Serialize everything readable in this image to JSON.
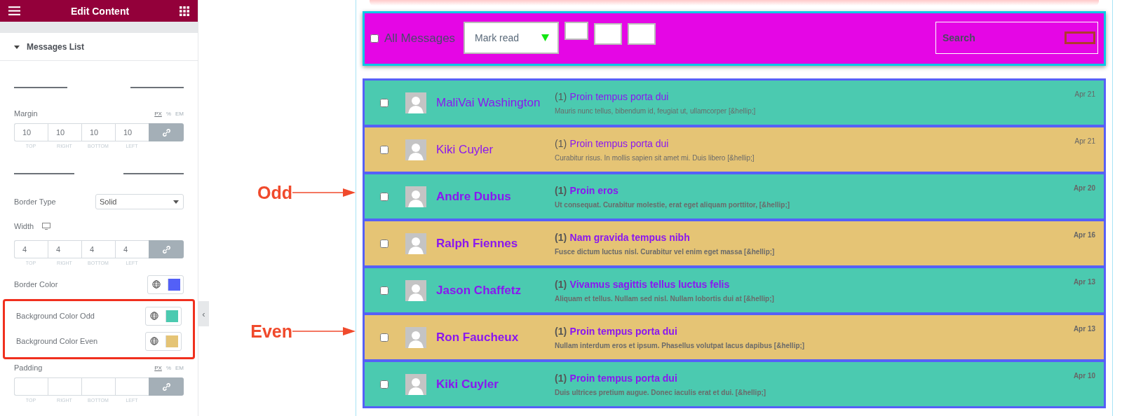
{
  "panel": {
    "title": "Edit Content",
    "section": "Messages List",
    "margin": {
      "label": "Margin",
      "units": [
        {
          "label": "PX",
          "selected": true
        },
        {
          "label": "%",
          "selected": false
        },
        {
          "label": "EM",
          "selected": false
        }
      ],
      "values": [
        "10",
        "10",
        "10",
        "10"
      ],
      "sides": [
        "TOP",
        "RIGHT",
        "BOTTOM",
        "LEFT"
      ]
    },
    "border_type": {
      "label": "Border Type",
      "value": "Solid"
    },
    "width": {
      "label": "Width",
      "values": [
        "4",
        "4",
        "4",
        "4"
      ],
      "sides": [
        "TOP",
        "RIGHT",
        "BOTTOM",
        "LEFT"
      ]
    },
    "colors": [
      {
        "label": "Border Color",
        "color": "#5360f7",
        "highlighted": false
      },
      {
        "label": "Background Color Odd",
        "color": "#4bcab0",
        "highlighted": true
      },
      {
        "label": "Background Color Even",
        "color": "#e5c475",
        "highlighted": true
      }
    ],
    "padding": {
      "label": "Padding",
      "units": [
        {
          "label": "PX",
          "selected": true
        },
        {
          "label": "%",
          "selected": false
        },
        {
          "label": "EM",
          "selected": false
        }
      ],
      "sides": [
        "TOP",
        "RIGHT",
        "BOTTOM",
        "LEFT"
      ]
    }
  },
  "toolbar": {
    "select_all_label": "All Messages",
    "select_all_checked": false,
    "action": "Mark read",
    "search": {
      "placeholder": "Search"
    }
  },
  "collapse_glyph": "‹",
  "messages": [
    {
      "name": "MaliVai Washington",
      "count": "(1)",
      "subject": "Proin tempus porta dui",
      "excerpt": "Mauris nunc tellus, bibendum id, feugiat ut, ullamcorper [&hellip;]",
      "date": "Apr 21",
      "unread": false,
      "checked": false,
      "color": "#4bcab0"
    },
    {
      "name": "Kiki Cuyler",
      "count": "(1)",
      "subject": "Proin tempus porta dui",
      "excerpt": "Curabitur risus. In mollis sapien sit amet mi. Duis libero [&hellip;]",
      "date": "Apr 21",
      "unread": false,
      "checked": false,
      "color": "#e5c475"
    },
    {
      "name": "Andre Dubus",
      "count": "(1)",
      "subject": "Proin eros",
      "excerpt": "Ut consequat. Curabitur molestie, erat eget aliquam porttitor, [&hellip;]",
      "date": "Apr 20",
      "annotation": "Odd",
      "unread": true,
      "checked": false,
      "color": "#4bcab0"
    },
    {
      "name": "Ralph Fiennes",
      "count": "(1)",
      "subject": "Nam gravida tempus nibh",
      "excerpt": "Fusce dictum luctus nisl. Curabitur vel enim eget massa [&hellip;]",
      "date": "Apr 16",
      "unread": true,
      "checked": false,
      "color": "#e5c475"
    },
    {
      "name": "Jason Chaffetz",
      "count": "(1)",
      "subject": "Vivamus sagittis tellus luctus felis",
      "excerpt": "Aliquam et tellus. Nullam sed nisl. Nullam lobortis dui at [&hellip;]",
      "date": "Apr 13",
      "unread": true,
      "checked": false,
      "color": "#4bcab0"
    },
    {
      "name": "Ron Faucheux",
      "count": "(1)",
      "subject": "Proin tempus porta dui",
      "excerpt": "Nullam interdum eros et ipsum. Phasellus volutpat lacus dapibus [&hellip;]",
      "date": "Apr 13",
      "annotation": "Even",
      "unread": true,
      "checked": false,
      "color": "#e5c475"
    },
    {
      "name": "Kiki Cuyler",
      "count": "(1)",
      "subject": "Proin tempus porta dui",
      "excerpt": "Duis ultrices pretium augue. Donec iaculis erat et dui. [&hellip;]",
      "date": "Apr 10",
      "unread": true,
      "checked": false,
      "color": "#4bcab0"
    }
  ]
}
